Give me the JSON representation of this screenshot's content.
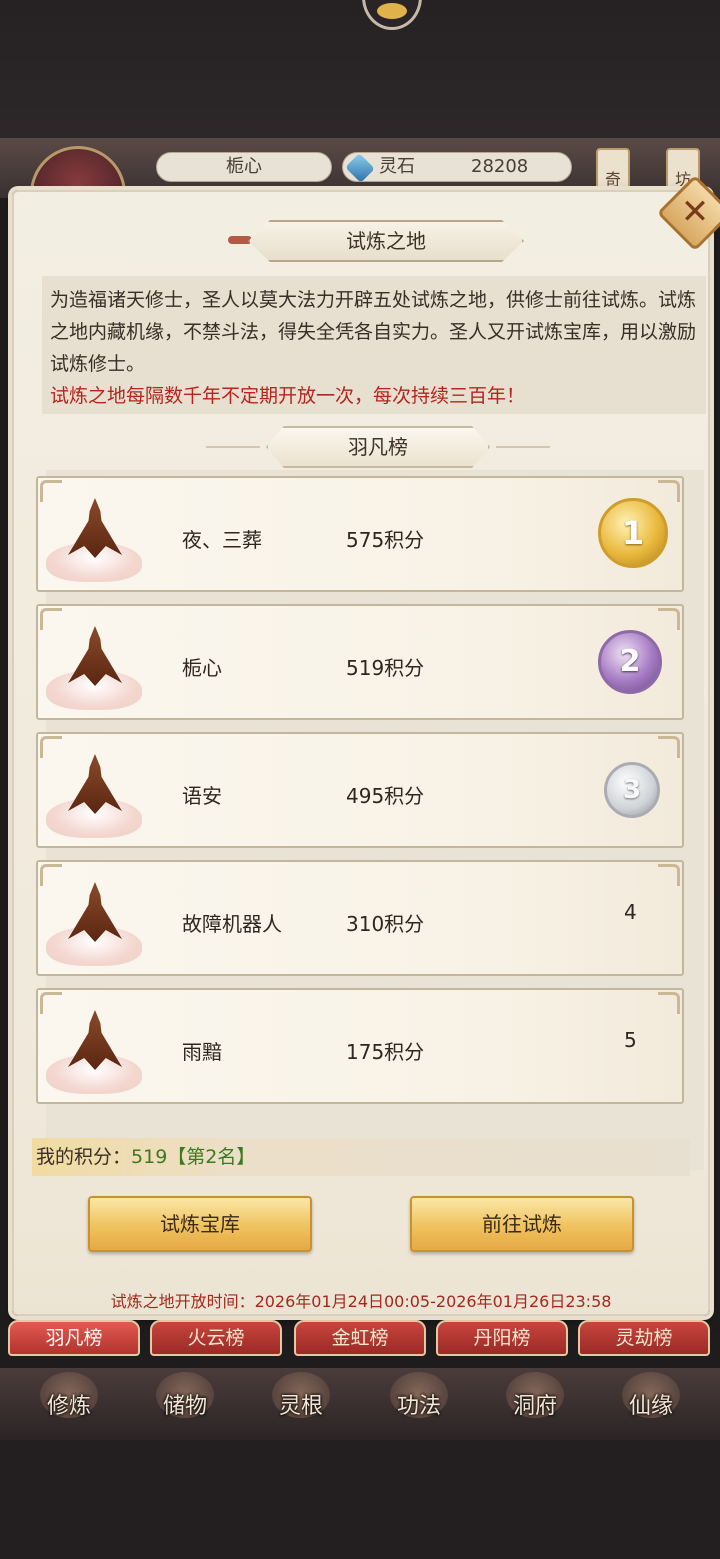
{
  "header": {
    "player_name": "栀心",
    "spirit_stone_label": "灵石",
    "spirit_stone_value": "28208",
    "side_left": "奇",
    "side_right": "坊"
  },
  "modal": {
    "title": "试炼之地",
    "close_symbol": "✕",
    "intro": "为造福诸天修士，圣人以莫大法力开辟五处试炼之地，供修士前往试炼。试炼之地内藏机缘，不禁斗法，得失全凭各自实力。圣人又开试炼宝库，用以激励试炼修士。",
    "intro_highlight": "试炼之地每隔数千年不定期开放一次，每次持续三百年！",
    "board_title": "羽凡榜",
    "rankings": [
      {
        "rank": "1",
        "name": "夜、三葬",
        "score": "575积分",
        "medal": "gold"
      },
      {
        "rank": "2",
        "name": "栀心",
        "score": "519积分",
        "medal": "purple"
      },
      {
        "rank": "3",
        "name": "语安",
        "score": "495积分",
        "medal": "silver"
      },
      {
        "rank": "4",
        "name": "故障机器人",
        "score": "310积分",
        "medal": ""
      },
      {
        "rank": "5",
        "name": "雨黯",
        "score": "175积分",
        "medal": ""
      }
    ],
    "my_score_label": "我的积分：",
    "my_score_value": "519",
    "my_rank": "【第2名】",
    "treasury_button": "试炼宝库",
    "go_button": "前往试炼",
    "open_time": "试炼之地开放时间：2026年01月24日00:05-2026年01月26日23:58"
  },
  "tabs": [
    "羽凡榜",
    "火云榜",
    "金虹榜",
    "丹阳榜",
    "灵劫榜"
  ],
  "active_tab": "羽凡榜",
  "nav": [
    "修炼",
    "储物",
    "灵根",
    "功法",
    "洞府",
    "仙缘"
  ]
}
